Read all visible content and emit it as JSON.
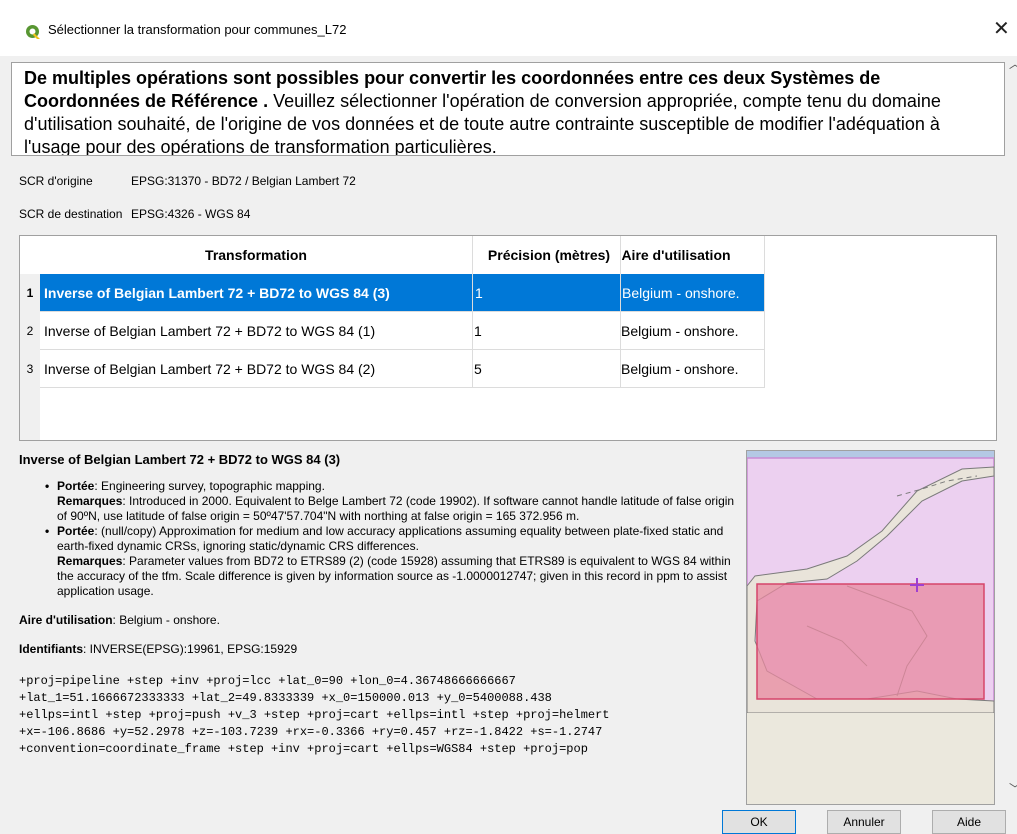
{
  "window": {
    "title": "Sélectionner la transformation pour communes_L72",
    "close_symbol": "✕"
  },
  "notice": {
    "bold": "De multiples opérations sont possibles pour convertir les coordonnées entre ces deux Systèmes de Coordonnées de Référence .",
    "text": " Veuillez sélectionner l'opération de conversion appropriée, compte tenu du domaine d'utilisation souhaité, de l'origine de vos données et de toute autre contrainte susceptible de modifier l'adéquation à l'usage pour des opérations de transformation particulières."
  },
  "crs": {
    "source_label": "SCR d'origine",
    "source_value": "EPSG:31370 - BD72 / Belgian Lambert 72",
    "dest_label": "SCR de destination",
    "dest_value": "EPSG:4326 - WGS 84"
  },
  "table": {
    "headers": [
      "Transformation",
      "Précision (mètres)",
      "Aire d'utilisation"
    ],
    "rows": [
      {
        "num": "1",
        "transformation": "Inverse of Belgian Lambert 72 + BD72 to WGS 84 (3)",
        "precision": "1",
        "area": "Belgium - onshore."
      },
      {
        "num": "2",
        "transformation": "Inverse of Belgian Lambert 72 + BD72 to WGS 84 (1)",
        "precision": "1",
        "area": "Belgium - onshore."
      },
      {
        "num": "3",
        "transformation": "Inverse of Belgian Lambert 72 + BD72 to WGS 84 (2)",
        "precision": "5",
        "area": "Belgium - onshore."
      }
    ],
    "selected_row": "1"
  },
  "details": {
    "title": "Inverse of Belgian Lambert 72 + BD72 to WGS 84 (3)",
    "items": [
      {
        "scope_label": "Portée",
        "scope": ": Engineering survey, topographic mapping.",
        "remarks_label": "Remarques",
        "remarks": ": Introduced in 2000. Equivalent to Belge Lambert 72 (code 19902). If software cannot handle latitude of false origin of 90ºN, use latitude of false origin = 50º47'57.704\"N with northing at false origin = 165 372.956 m."
      },
      {
        "scope_label": "Portée",
        "scope": ": (null/copy) Approximation for medium and low accuracy applications assuming equality between plate-fixed static and earth-fixed dynamic CRSs, ignoring static/dynamic CRS differences.",
        "remarks_label": "Remarques",
        "remarks": ": Parameter values from BD72 to ETRS89 (2) (code 15928) assuming that ETRS89 is equivalent to WGS 84 within the accuracy of the tfm. Scale difference is given by information source as -1.0000012747; given in this record in ppm to assist application usage."
      }
    ],
    "area_label": "Aire d'utilisation",
    "area_value": ": Belgium - onshore.",
    "ids_label": "Identifiants",
    "ids_value": ": INVERSE(EPSG):19961, EPSG:15929",
    "proj_lines": [
      "+proj=pipeline +step +inv +proj=lcc +lat_0=90 +lon_0=4.36748666666667",
      "+lat_1=51.1666672333333 +lat_2=49.8333339 +x_0=150000.013 +y_0=5400088.438",
      "+ellps=intl +step +proj=push +v_3 +step +proj=cart +ellps=intl +step +proj=helmert",
      "+x=-106.8686 +y=52.2978 +z=-103.7239 +rx=-0.3366 +ry=0.457 +rz=-1.8422 +s=-1.2747",
      "+convention=coordinate_frame +step +inv +proj=cart +ellps=WGS84 +step +proj=pop"
    ]
  },
  "buttons": {
    "ok": "OK",
    "cancel": "Annuler",
    "help": "Aide"
  },
  "colors": {
    "selection": "#0078d7",
    "map_extent_outer": "#e8c8ec",
    "map_extent_inner": "#e88aa0"
  }
}
